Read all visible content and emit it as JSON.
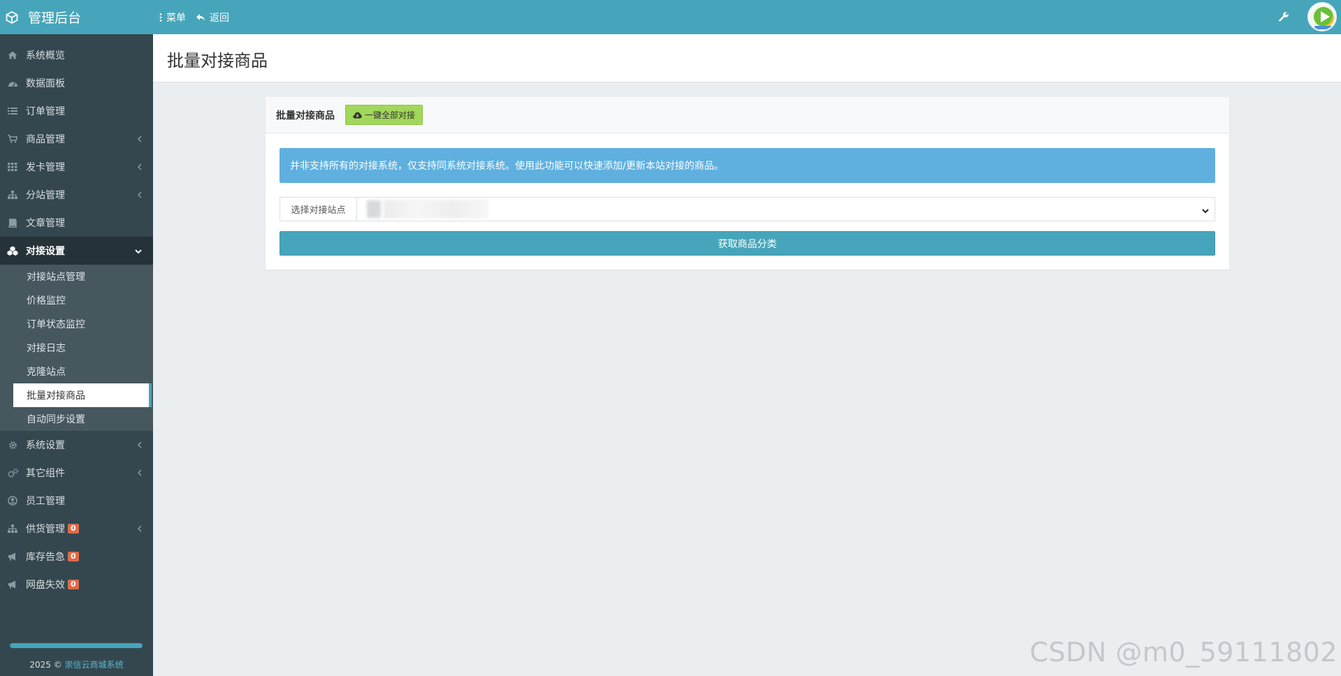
{
  "brand": {
    "title": "管理后台",
    "icon": "cube-icon"
  },
  "topnav": {
    "menu_label": "菜单",
    "back_label": "返回"
  },
  "sidebar": {
    "items": [
      {
        "label": "系统概览",
        "icon": "home-icon"
      },
      {
        "label": "数据面板",
        "icon": "dashboard-icon"
      },
      {
        "label": "订单管理",
        "icon": "list-icon"
      },
      {
        "label": "商品管理",
        "icon": "cart-icon",
        "has_children": true
      },
      {
        "label": "发卡管理",
        "icon": "grid-icon",
        "has_children": true
      },
      {
        "label": "分站管理",
        "icon": "sitemap-icon",
        "has_children": true
      },
      {
        "label": "文章管理",
        "icon": "book-icon"
      },
      {
        "label": "对接设置",
        "icon": "cubes-icon",
        "expanded": true
      }
    ],
    "submenu": [
      {
        "label": "对接站点管理"
      },
      {
        "label": "价格监控"
      },
      {
        "label": "订单状态监控"
      },
      {
        "label": "对接日志"
      },
      {
        "label": "克隆站点"
      },
      {
        "label": "批量对接商品",
        "current": true
      },
      {
        "label": "自动同步设置"
      }
    ],
    "items_after": [
      {
        "label": "系统设置",
        "icon": "gear-icon",
        "has_children": true
      },
      {
        "label": "其它组件",
        "icon": "cogs-icon",
        "has_children": true
      },
      {
        "label": "员工管理",
        "icon": "user-circle-icon"
      },
      {
        "label": "供货管理",
        "icon": "sitemap-icon",
        "badge": "0",
        "has_children": true
      },
      {
        "label": "库存告急",
        "icon": "megaphone-icon",
        "badge": "0"
      },
      {
        "label": "网盘失效",
        "icon": "megaphone-icon",
        "badge": "0"
      }
    ],
    "footer": {
      "progress": 1.0,
      "copyright_prefix": "2025 © ",
      "copyright_link": "崇信云商城系统"
    }
  },
  "page": {
    "title": "批量对接商品"
  },
  "panel": {
    "title": "批量对接商品",
    "one_click_label": "一键全部对接",
    "alert": "并非支持所有的对接系统，仅支持同系统对接系统。使用此功能可以快速添加/更新本站对接的商品。",
    "select_label": "选择对接站点",
    "fetch_label": "获取商品分类"
  },
  "watermark": "CSDN @m0_59111802",
  "colors": {
    "topbar": "#46a5ba",
    "sidebar": "#34474f",
    "alert": "#5fb0df",
    "primary": "#46a5ba",
    "success": "#a1d75a",
    "badge": "#e06a48"
  }
}
